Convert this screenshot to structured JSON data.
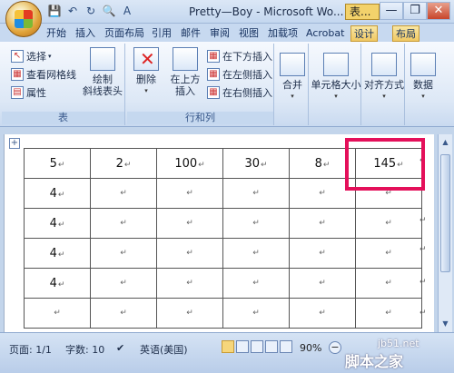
{
  "window": {
    "title": "Pretty—Boy - Microsoft Wo...",
    "context_title": "表...",
    "minimize": "—",
    "restore": "❐",
    "close": "✕"
  },
  "tabs": [
    "开始",
    "插入",
    "页面布局",
    "引用",
    "邮件",
    "审阅",
    "视图",
    "加载项",
    "Acrobat",
    "设计",
    "布局"
  ],
  "active_tab": "布局",
  "ribbon": {
    "table_group": {
      "label": "表",
      "select": "选择",
      "gridlines": "查看网格线",
      "properties": "属性",
      "draw_diag_1": "绘制",
      "draw_diag_2": "斜线表头"
    },
    "rows_cols_group": {
      "label": "行和列",
      "delete": "删除",
      "insert_above_1": "在上方",
      "insert_above_2": "插入",
      "insert_below": "在下方插入",
      "insert_left": "在左侧插入",
      "insert_right": "在右侧插入"
    },
    "merge": "合并",
    "cell_size": "单元格大小",
    "alignment": "对齐方式",
    "data": "数据"
  },
  "table": {
    "rows": [
      [
        "5",
        "2",
        "100",
        "30",
        "8",
        "145"
      ],
      [
        "4",
        "",
        "",
        "",
        "",
        ""
      ],
      [
        "4",
        "",
        "",
        "",
        "",
        ""
      ],
      [
        "4",
        "",
        "",
        "",
        "",
        ""
      ],
      [
        "4",
        "",
        "",
        "",
        "",
        ""
      ],
      [
        "",
        "",
        "",
        "",
        "",
        ""
      ]
    ],
    "cell_mark": "↵",
    "highlighted_cell": "145"
  },
  "status": {
    "page": "页面: 1/1",
    "words": "字数: 10",
    "language": "英语(美国)",
    "zoom": "90%"
  },
  "watermark": {
    "line1": "jb51.net",
    "line2": "脚本之家"
  },
  "colors": {
    "highlight": "#e4105a",
    "ribbon_bg": "#dde8f6"
  }
}
